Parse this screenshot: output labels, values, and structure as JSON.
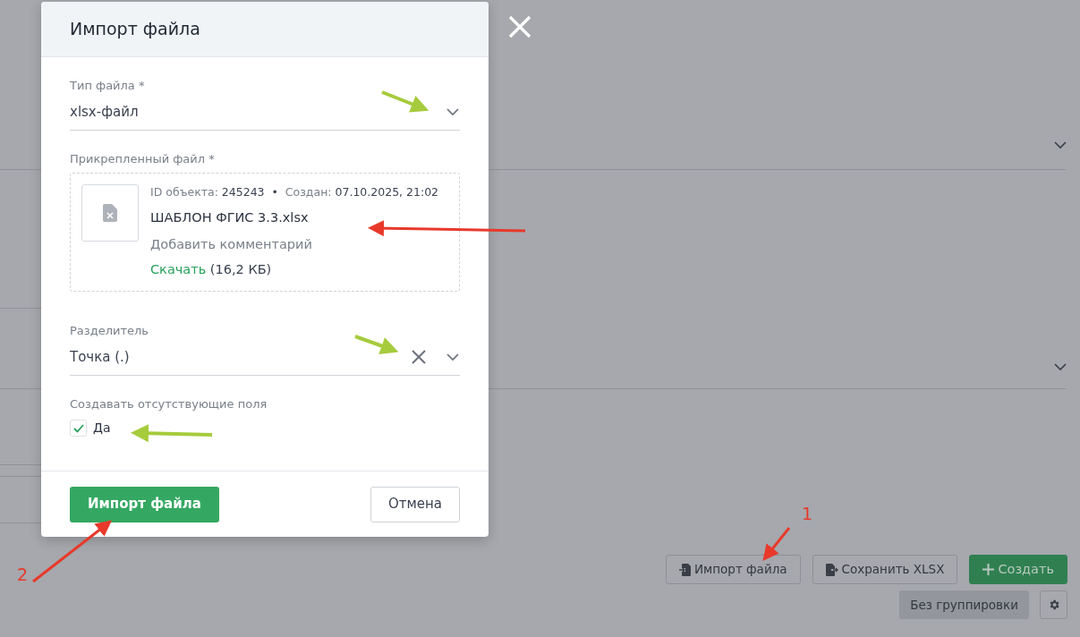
{
  "dialog": {
    "title": "Импорт файла",
    "fields": [
      {
        "kind": "select",
        "label": "Тип файла *",
        "value": "xlsx-файл",
        "clearable": false
      },
      {
        "kind": "file",
        "label": "Прикрепленный файл *",
        "file": {
          "id_label": "ID объекта:",
          "id": "245243",
          "separator": "•",
          "created_label": "Создан:",
          "created": "07.10.2025, 21:02",
          "name": "ШАБЛОН ФГИС 3.3.xlsx",
          "comment_placeholder": "Добавить комментарий",
          "download": "Скачать",
          "size": "(16,2 КБ)"
        }
      },
      {
        "kind": "select",
        "label": "Разделитель",
        "value": "Точка (.)",
        "clearable": true
      },
      {
        "kind": "checkbox",
        "label": "Создавать отсутствующие поля",
        "option": "Да",
        "checked": true
      }
    ],
    "buttons": [
      {
        "label": "Импорт файла",
        "kind": "primary"
      },
      {
        "label": "Отмена",
        "kind": "secondary"
      }
    ]
  },
  "background": {
    "toolbar": [
      {
        "label": "Импорт файла",
        "kind": "import"
      },
      {
        "label": "Сохранить XLSX",
        "kind": "export"
      },
      {
        "label": "Создать",
        "kind": "create"
      }
    ],
    "grouping": "Без группировки"
  },
  "annotations": [
    {
      "label": "1"
    },
    {
      "label": "2"
    }
  ]
}
